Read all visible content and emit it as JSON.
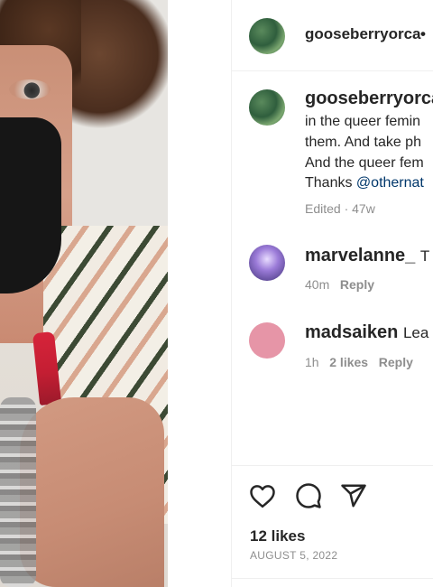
{
  "post": {
    "author": "gooseberryorca",
    "header_dot": "•"
  },
  "caption": {
    "author": "gooseberryorca",
    "lines": [
      "in the queer femin",
      "them. And take ph",
      "And the queer fem",
      "Thanks "
    ],
    "mention": "@othernat",
    "meta": "Edited · 47w"
  },
  "comments": [
    {
      "author": "marvelanne_",
      "text": "T",
      "time": "40m",
      "reply": "Reply"
    },
    {
      "author": "madsaiken",
      "text": "Lea",
      "time": "1h",
      "likes": "2 likes",
      "reply": "Reply"
    }
  ],
  "actions": {
    "like_icon": "heart-icon",
    "comment_icon": "comment-icon",
    "share_icon": "share-icon"
  },
  "stats": {
    "likes": "12 likes",
    "date": "AUGUST 5, 2022"
  },
  "nav": {
    "next_glyph": "›"
  },
  "colors": {
    "link": "#00376b",
    "muted": "#8e8e8e",
    "text": "#262626"
  }
}
